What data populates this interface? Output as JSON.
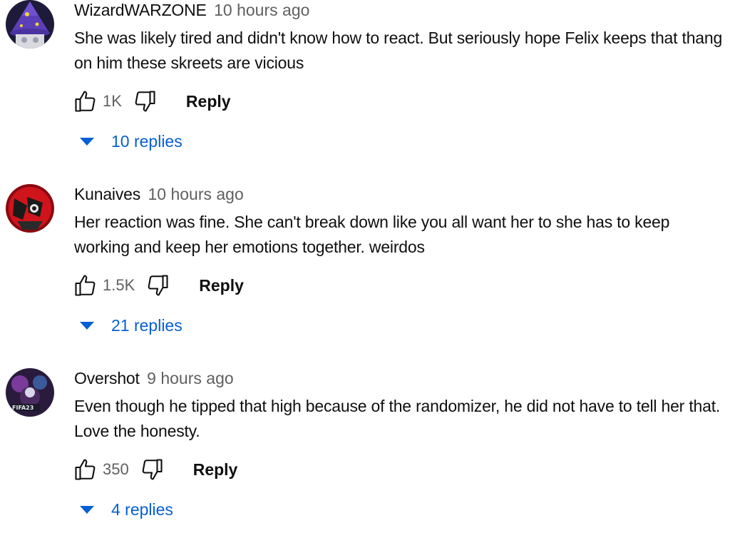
{
  "comments": [
    {
      "author": "WizardWARZONE",
      "time": "10 hours ago",
      "text": "She was likely tired and didn't know how to react. But seriously hope Felix keeps that thang on him these skreets are vicious",
      "likes": "1K",
      "reply_label": "Reply",
      "replies_label": "10 replies",
      "avatar_icon": "wizard-hat-avatar",
      "avatar_colors": [
        "#5b3fb8",
        "#1e1a3a",
        "#f2d13a"
      ]
    },
    {
      "author": "Kunaives",
      "time": "10 hours ago",
      "text": "Her reaction was fine. She can't break down like you all want her to she has to keep working and keep her emotions together. weirdos",
      "likes": "1.5K",
      "reply_label": "Reply",
      "replies_label": "21 replies",
      "avatar_icon": "red-anime-avatar",
      "avatar_colors": [
        "#d0141c",
        "#1a1a1a",
        "#8a0a10"
      ]
    },
    {
      "author": "Overshot",
      "time": "9 hours ago",
      "text": "Even though he tipped that high because of the randomizer, he did not have to tell her that. Love the honesty.",
      "likes": "350",
      "reply_label": "Reply",
      "replies_label": "4 replies",
      "avatar_icon": "gaming-avatar",
      "avatar_colors": [
        "#2a1b3d",
        "#7a3b9a",
        "#d8d8e8"
      ],
      "avatar_text": "FIFA23"
    }
  ],
  "colors": {
    "link_blue": "#065fd4",
    "meta_gray": "#606060",
    "text": "#0f0f0f"
  }
}
